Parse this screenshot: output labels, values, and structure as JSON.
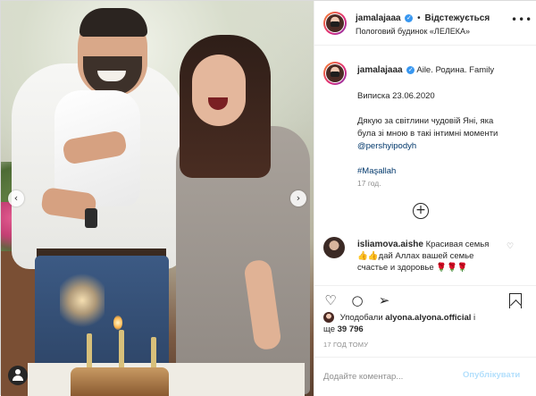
{
  "header": {
    "username": "jamalajaaa",
    "verified_mark": "✓",
    "separator": "•",
    "follow_label": "Відстежується",
    "location": "Пологовий будинок «ЛЕЛЕКА»",
    "more_label": "•••"
  },
  "caption": {
    "username": "jamalajaaa",
    "verified_mark": "✓",
    "line1": "Aile. Родина. Family",
    "line2": "Виписка 23.06.2020",
    "line3a": "Дякую за світлини чудовій Яні, яка",
    "line3b": "була зі мною в такі інтимні моменти",
    "mention": "@pershyipodyh",
    "hashtag": "#Maşallah",
    "time": "17 год."
  },
  "more_comments_label": "+",
  "comment": {
    "username": "isliamova.aishe",
    "text_line1": "Красивая семья",
    "text_line2": "👍👍дай Аллах вашей семье",
    "text_line3": "счастье и здоровье 🌹🌹🌹",
    "heart": "♡"
  },
  "actions": {
    "like_icon": "♡",
    "comment_icon": "○",
    "share_icon": "➢"
  },
  "likes": {
    "prefix": "Уподобали",
    "user": "alyona.alyona.official",
    "suffix_a": "і",
    "suffix_b": "ще",
    "count": "39 796"
  },
  "timestamp": "17 ГОД ТОМУ",
  "add_comment": {
    "placeholder": "Додайте коментар...",
    "publish_label": "Опублікувати"
  },
  "photo": {
    "prev_arrow": "‹",
    "next_arrow": "›"
  },
  "colors": {
    "verified": "#3897f0",
    "publish_disabled": "#b2dffc",
    "mention": "#00376b",
    "muted": "#8e8e8e"
  }
}
